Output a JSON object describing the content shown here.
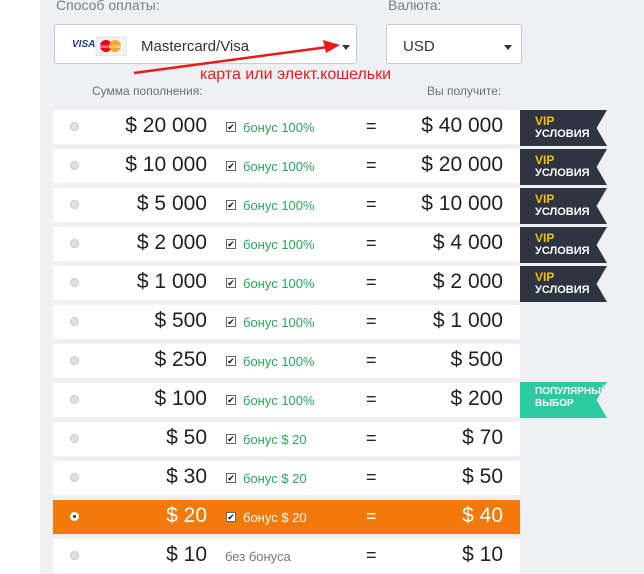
{
  "payment": {
    "label": "Способ оплаты:",
    "method": "Mastercard/Visa",
    "card_brand_text": "VISA",
    "card_mc_text": "MasterCard"
  },
  "currency": {
    "label": "Валюта:",
    "value": "USD"
  },
  "annotation": "карта или элект.кошельки",
  "columns": {
    "deposit": "Сумма пополнения:",
    "receive": "Вы получите:"
  },
  "eq_sign": "=",
  "rows": [
    {
      "amount": "$ 20 000",
      "bonus": "бонус 100%",
      "receive": "$ 40 000"
    },
    {
      "amount": "$ 10 000",
      "bonus": "бонус 100%",
      "receive": "$ 20 000"
    },
    {
      "amount": "$ 5 000",
      "bonus": "бонус 100%",
      "receive": "$ 10 000"
    },
    {
      "amount": "$ 2 000",
      "bonus": "бонус 100%",
      "receive": "$ 4 000"
    },
    {
      "amount": "$ 1 000",
      "bonus": "бонус 100%",
      "receive": "$ 2 000"
    },
    {
      "amount": "$ 500",
      "bonus": "бонус 100%",
      "receive": "$ 1 000"
    },
    {
      "amount": "$ 250",
      "bonus": "бонус 100%",
      "receive": "$ 500"
    },
    {
      "amount": "$ 100",
      "bonus": "бонус 100%",
      "receive": "$ 200"
    },
    {
      "amount": "$ 50",
      "bonus": "бонус $ 20",
      "receive": "$ 70"
    },
    {
      "amount": "$ 30",
      "bonus": "бонус $ 20",
      "receive": "$ 50"
    },
    {
      "amount": "$ 20",
      "bonus": "бонус $ 20",
      "receive": "$ 40",
      "selected": true
    },
    {
      "amount": "$ 10",
      "bonus": "без бонуса",
      "receive": "$ 10"
    }
  ],
  "badges": {
    "vip_line1": "VIP",
    "vip_line2": "УСЛОВИЯ",
    "popular": "ПОПУЛЯРНЫЙ ВЫБОР"
  },
  "colors": {
    "selected_row": "#f4790b",
    "bonus_text": "#27a85a",
    "vip_ribbon": "#2e3442",
    "vip_text": "#f5c200",
    "popular_ribbon": "#2ccaa0",
    "annotation": "#e81b1b"
  }
}
